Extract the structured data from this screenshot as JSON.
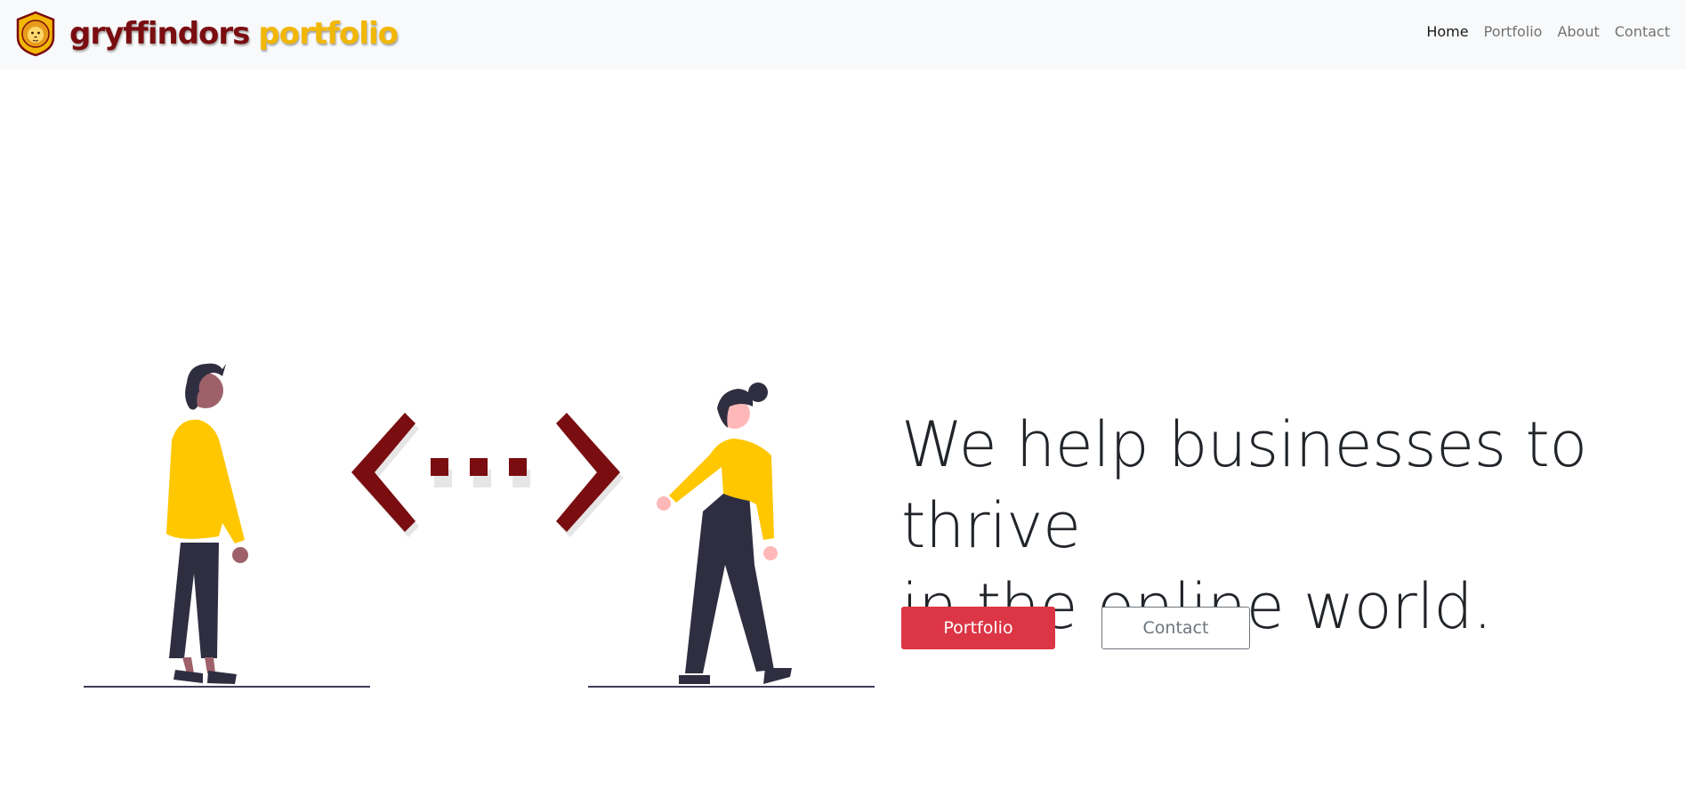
{
  "brand": {
    "word1": "gryffindors",
    "word2": "portfolio",
    "logo_icon": "lion-crest-icon",
    "colors": {
      "primary": "#7a0d10",
      "gold": "#f2b705"
    }
  },
  "nav": {
    "items": [
      {
        "label": "Home",
        "active": true
      },
      {
        "label": "Portfolio",
        "active": false
      },
      {
        "label": "About",
        "active": false
      },
      {
        "label": "Contact",
        "active": false
      }
    ]
  },
  "hero": {
    "headline_line1": "We help businesses to thrive",
    "headline_line2": "in the online world.",
    "primary_button": "Portfolio",
    "secondary_button": "Contact",
    "illustration_icon": "people-code-illustration-icon",
    "colors": {
      "accent": "#dc3545",
      "code_symbol": "#7a0d10",
      "shirt": "#ffc700"
    }
  }
}
